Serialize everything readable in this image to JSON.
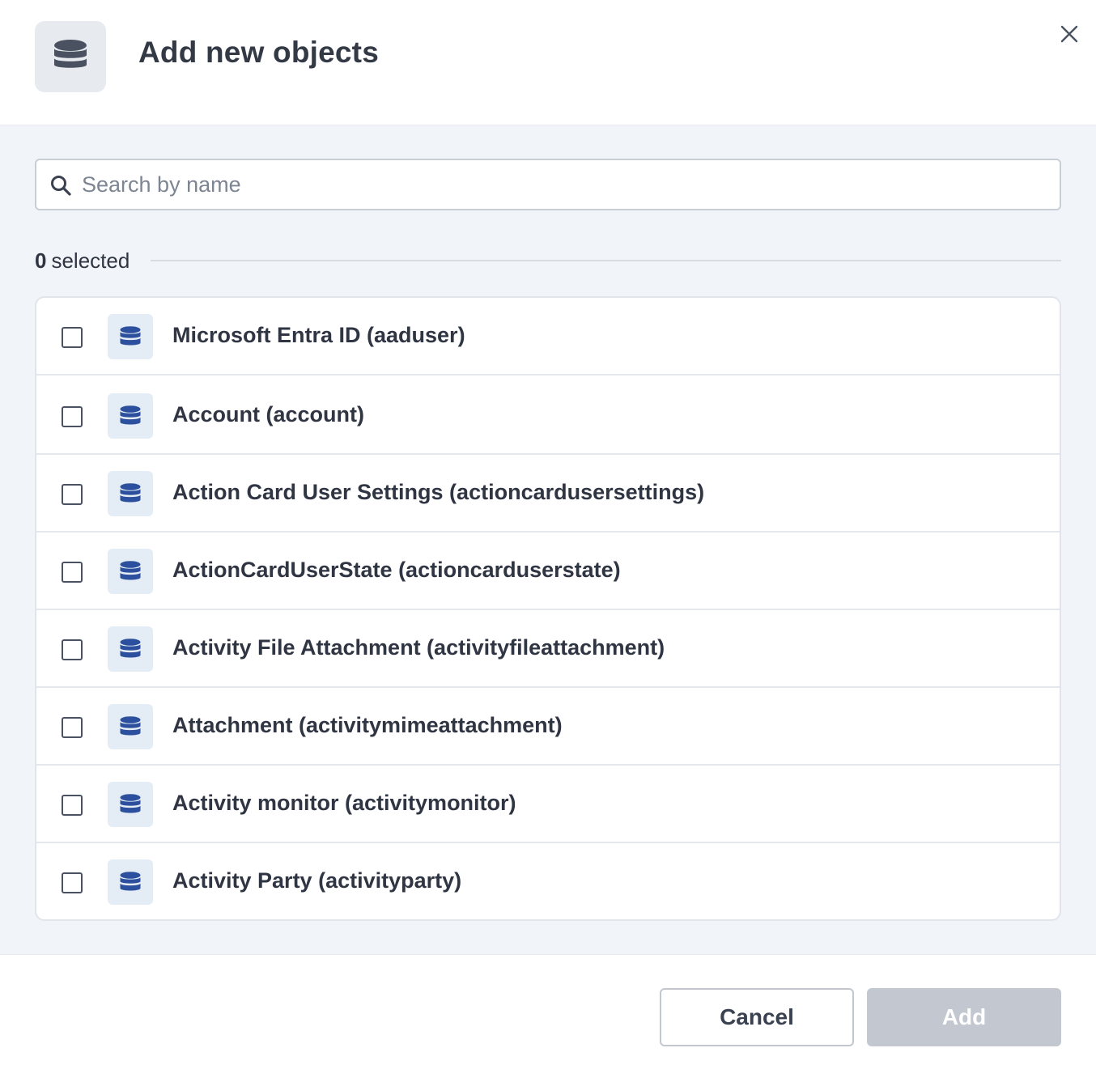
{
  "dialog": {
    "title": "Add new objects",
    "header_icon": "database-icon",
    "close_icon": "close-icon"
  },
  "search": {
    "placeholder": "Search by name",
    "value": "",
    "icon": "search-icon"
  },
  "selection": {
    "count": "0",
    "label": "selected"
  },
  "items": [
    {
      "label": "Microsoft Entra ID (aaduser)",
      "checked": false,
      "icon": "database-icon"
    },
    {
      "label": "Account (account)",
      "checked": false,
      "icon": "database-icon"
    },
    {
      "label": "Action Card User Settings (actioncardusersettings)",
      "checked": false,
      "icon": "database-icon"
    },
    {
      "label": "ActionCardUserState (actioncarduserstate)",
      "checked": false,
      "icon": "database-icon"
    },
    {
      "label": "Activity File Attachment (activityfileattachment)",
      "checked": false,
      "icon": "database-icon"
    },
    {
      "label": "Attachment (activitymimeattachment)",
      "checked": false,
      "icon": "database-icon"
    },
    {
      "label": "Activity monitor (activitymonitor)",
      "checked": false,
      "icon": "database-icon"
    },
    {
      "label": "Activity Party (activityparty)",
      "checked": false,
      "icon": "database-icon"
    }
  ],
  "footer": {
    "cancel_label": "Cancel",
    "add_label": "Add",
    "add_disabled": true
  },
  "colors": {
    "item_icon": "#2c4f9e",
    "header_icon": "#4a5261",
    "add_button_disabled": "#c3c8d0",
    "body_background": "#f1f4f8"
  }
}
